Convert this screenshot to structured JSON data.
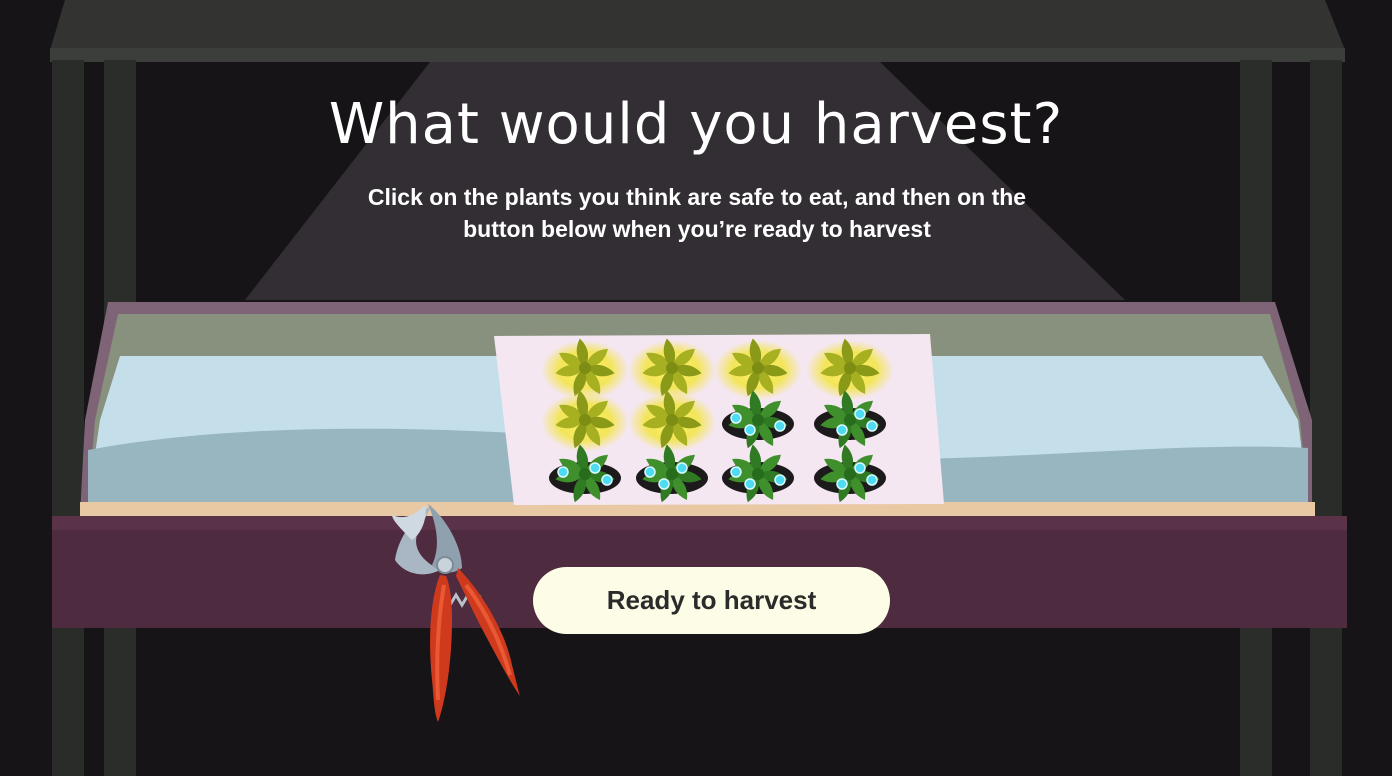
{
  "title": "What would you harvest?",
  "instructions": "Click on the plants you think are safe to eat, and then on the button below when you’re ready to harvest",
  "button": {
    "label": "Ready to harvest"
  },
  "colors": {
    "background": "#161416",
    "spotlight": "#332e33",
    "shelf_frame": "#4e2b3f",
    "tray_rim": "#87917d",
    "water": "#c4dfea",
    "button_bg": "#fdfce6",
    "highlight": "#f5e84a",
    "healthy_plant": "#3f8f2c",
    "unhealthy_plant": "#a7b020",
    "spots": "#4fdcf2"
  },
  "plants": [
    {
      "row": 1,
      "col": 1,
      "appearance": "yellow-glow"
    },
    {
      "row": 1,
      "col": 2,
      "appearance": "yellow-glow"
    },
    {
      "row": 1,
      "col": 3,
      "appearance": "yellow-glow"
    },
    {
      "row": 1,
      "col": 4,
      "appearance": "yellow-glow"
    },
    {
      "row": 2,
      "col": 1,
      "appearance": "yellow-glow"
    },
    {
      "row": 2,
      "col": 2,
      "appearance": "yellow-glow"
    },
    {
      "row": 2,
      "col": 3,
      "appearance": "green-blue-spots"
    },
    {
      "row": 2,
      "col": 4,
      "appearance": "green-blue-spots"
    },
    {
      "row": 3,
      "col": 1,
      "appearance": "green-blue-spots"
    },
    {
      "row": 3,
      "col": 2,
      "appearance": "green-blue-spots"
    },
    {
      "row": 3,
      "col": 3,
      "appearance": "green-blue-spots"
    },
    {
      "row": 3,
      "col": 4,
      "appearance": "green-blue-spots"
    }
  ],
  "tool": {
    "icon": "pruning-shears-icon"
  }
}
